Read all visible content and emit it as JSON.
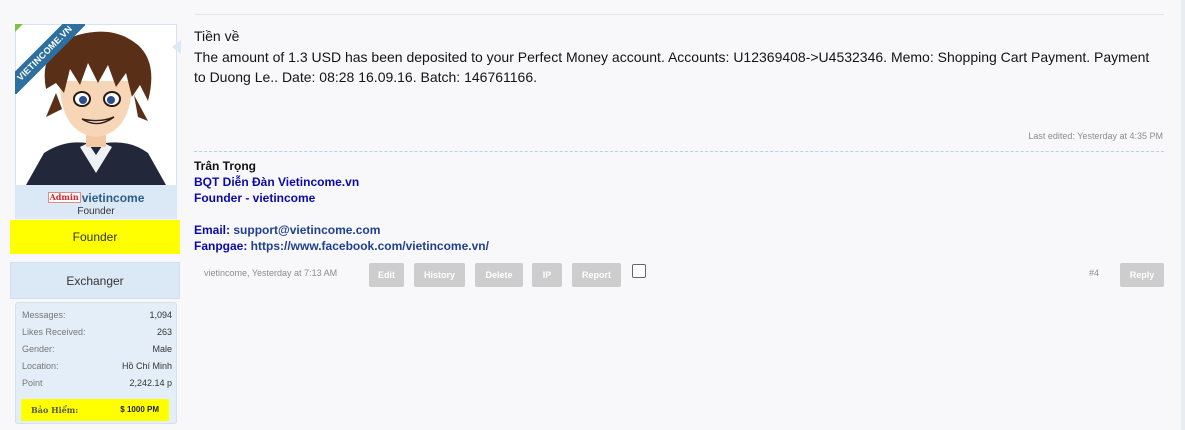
{
  "user": {
    "avatar_ribbon": "VIETINCOME.VN",
    "admin_badge": "Admin",
    "username": "vietincome",
    "title": "Founder",
    "banners": [
      "Founder",
      "Exchanger"
    ],
    "stats": [
      {
        "label": "Messages:",
        "value": "1,094"
      },
      {
        "label": "Likes Received:",
        "value": "263"
      },
      {
        "label": "Gender:",
        "value": "Male"
      },
      {
        "label": "Location:",
        "value": "Hồ Chí Minh"
      },
      {
        "label": "Point",
        "value": "2,242.14 p"
      }
    ],
    "insurance": {
      "label": "Bảo Hiểm:",
      "value": "$ 1000 PM"
    }
  },
  "message": {
    "title": "Tiền về",
    "body": "The amount of 1.3 USD has been deposited to your Perfect Money account. Accounts: U12369408->U4532346. Memo: Shopping Cart Payment. Payment to Duong Le.. Date: 08:28 16.09.16. Batch: 146761166.",
    "last_edited": "Last edited: Yesterday at 4:35 PM"
  },
  "signature": {
    "name": "Trân Trọng",
    "line1": "BQT Diễn Đàn Vietincome.vn",
    "line2": "Founder - vietincome",
    "email_label": "Email: ",
    "email": "support@vietincome.com",
    "fanpage_label": "Fanpgae: ",
    "fanpage": "https://www.facebook.com/vietincome.vn/"
  },
  "controls": {
    "byline": "vietincome, Yesterday at 7:13 AM",
    "edit": "Edit",
    "history": "History",
    "delete": "Delete",
    "ip": "IP",
    "report": "Report",
    "post_number": "#4",
    "reply": "Reply"
  },
  "colors": {
    "accent": "#2b5c87",
    "highlight": "#ffff00",
    "panel": "#dbe9f6",
    "button": "#cdcdcd"
  }
}
